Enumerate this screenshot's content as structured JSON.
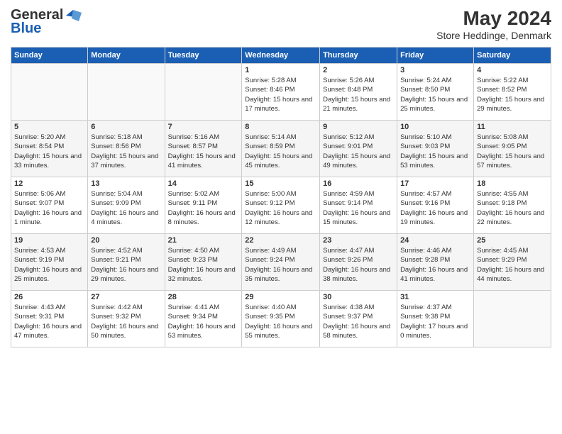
{
  "header": {
    "logo_general": "General",
    "logo_blue": "Blue",
    "title": "May 2024",
    "subtitle": "Store Heddinge, Denmark"
  },
  "calendar": {
    "days_of_week": [
      "Sunday",
      "Monday",
      "Tuesday",
      "Wednesday",
      "Thursday",
      "Friday",
      "Saturday"
    ],
    "weeks": [
      [
        {
          "day": "",
          "sunrise": "",
          "sunset": "",
          "daylight": ""
        },
        {
          "day": "",
          "sunrise": "",
          "sunset": "",
          "daylight": ""
        },
        {
          "day": "",
          "sunrise": "",
          "sunset": "",
          "daylight": ""
        },
        {
          "day": "1",
          "sunrise": "Sunrise: 5:28 AM",
          "sunset": "Sunset: 8:46 PM",
          "daylight": "Daylight: 15 hours and 17 minutes."
        },
        {
          "day": "2",
          "sunrise": "Sunrise: 5:26 AM",
          "sunset": "Sunset: 8:48 PM",
          "daylight": "Daylight: 15 hours and 21 minutes."
        },
        {
          "day": "3",
          "sunrise": "Sunrise: 5:24 AM",
          "sunset": "Sunset: 8:50 PM",
          "daylight": "Daylight: 15 hours and 25 minutes."
        },
        {
          "day": "4",
          "sunrise": "Sunrise: 5:22 AM",
          "sunset": "Sunset: 8:52 PM",
          "daylight": "Daylight: 15 hours and 29 minutes."
        }
      ],
      [
        {
          "day": "5",
          "sunrise": "Sunrise: 5:20 AM",
          "sunset": "Sunset: 8:54 PM",
          "daylight": "Daylight: 15 hours and 33 minutes."
        },
        {
          "day": "6",
          "sunrise": "Sunrise: 5:18 AM",
          "sunset": "Sunset: 8:56 PM",
          "daylight": "Daylight: 15 hours and 37 minutes."
        },
        {
          "day": "7",
          "sunrise": "Sunrise: 5:16 AM",
          "sunset": "Sunset: 8:57 PM",
          "daylight": "Daylight: 15 hours and 41 minutes."
        },
        {
          "day": "8",
          "sunrise": "Sunrise: 5:14 AM",
          "sunset": "Sunset: 8:59 PM",
          "daylight": "Daylight: 15 hours and 45 minutes."
        },
        {
          "day": "9",
          "sunrise": "Sunrise: 5:12 AM",
          "sunset": "Sunset: 9:01 PM",
          "daylight": "Daylight: 15 hours and 49 minutes."
        },
        {
          "day": "10",
          "sunrise": "Sunrise: 5:10 AM",
          "sunset": "Sunset: 9:03 PM",
          "daylight": "Daylight: 15 hours and 53 minutes."
        },
        {
          "day": "11",
          "sunrise": "Sunrise: 5:08 AM",
          "sunset": "Sunset: 9:05 PM",
          "daylight": "Daylight: 15 hours and 57 minutes."
        }
      ],
      [
        {
          "day": "12",
          "sunrise": "Sunrise: 5:06 AM",
          "sunset": "Sunset: 9:07 PM",
          "daylight": "Daylight: 16 hours and 1 minute."
        },
        {
          "day": "13",
          "sunrise": "Sunrise: 5:04 AM",
          "sunset": "Sunset: 9:09 PM",
          "daylight": "Daylight: 16 hours and 4 minutes."
        },
        {
          "day": "14",
          "sunrise": "Sunrise: 5:02 AM",
          "sunset": "Sunset: 9:11 PM",
          "daylight": "Daylight: 16 hours and 8 minutes."
        },
        {
          "day": "15",
          "sunrise": "Sunrise: 5:00 AM",
          "sunset": "Sunset: 9:12 PM",
          "daylight": "Daylight: 16 hours and 12 minutes."
        },
        {
          "day": "16",
          "sunrise": "Sunrise: 4:59 AM",
          "sunset": "Sunset: 9:14 PM",
          "daylight": "Daylight: 16 hours and 15 minutes."
        },
        {
          "day": "17",
          "sunrise": "Sunrise: 4:57 AM",
          "sunset": "Sunset: 9:16 PM",
          "daylight": "Daylight: 16 hours and 19 minutes."
        },
        {
          "day": "18",
          "sunrise": "Sunrise: 4:55 AM",
          "sunset": "Sunset: 9:18 PM",
          "daylight": "Daylight: 16 hours and 22 minutes."
        }
      ],
      [
        {
          "day": "19",
          "sunrise": "Sunrise: 4:53 AM",
          "sunset": "Sunset: 9:19 PM",
          "daylight": "Daylight: 16 hours and 25 minutes."
        },
        {
          "day": "20",
          "sunrise": "Sunrise: 4:52 AM",
          "sunset": "Sunset: 9:21 PM",
          "daylight": "Daylight: 16 hours and 29 minutes."
        },
        {
          "day": "21",
          "sunrise": "Sunrise: 4:50 AM",
          "sunset": "Sunset: 9:23 PM",
          "daylight": "Daylight: 16 hours and 32 minutes."
        },
        {
          "day": "22",
          "sunrise": "Sunrise: 4:49 AM",
          "sunset": "Sunset: 9:24 PM",
          "daylight": "Daylight: 16 hours and 35 minutes."
        },
        {
          "day": "23",
          "sunrise": "Sunrise: 4:47 AM",
          "sunset": "Sunset: 9:26 PM",
          "daylight": "Daylight: 16 hours and 38 minutes."
        },
        {
          "day": "24",
          "sunrise": "Sunrise: 4:46 AM",
          "sunset": "Sunset: 9:28 PM",
          "daylight": "Daylight: 16 hours and 41 minutes."
        },
        {
          "day": "25",
          "sunrise": "Sunrise: 4:45 AM",
          "sunset": "Sunset: 9:29 PM",
          "daylight": "Daylight: 16 hours and 44 minutes."
        }
      ],
      [
        {
          "day": "26",
          "sunrise": "Sunrise: 4:43 AM",
          "sunset": "Sunset: 9:31 PM",
          "daylight": "Daylight: 16 hours and 47 minutes."
        },
        {
          "day": "27",
          "sunrise": "Sunrise: 4:42 AM",
          "sunset": "Sunset: 9:32 PM",
          "daylight": "Daylight: 16 hours and 50 minutes."
        },
        {
          "day": "28",
          "sunrise": "Sunrise: 4:41 AM",
          "sunset": "Sunset: 9:34 PM",
          "daylight": "Daylight: 16 hours and 53 minutes."
        },
        {
          "day": "29",
          "sunrise": "Sunrise: 4:40 AM",
          "sunset": "Sunset: 9:35 PM",
          "daylight": "Daylight: 16 hours and 55 minutes."
        },
        {
          "day": "30",
          "sunrise": "Sunrise: 4:38 AM",
          "sunset": "Sunset: 9:37 PM",
          "daylight": "Daylight: 16 hours and 58 minutes."
        },
        {
          "day": "31",
          "sunrise": "Sunrise: 4:37 AM",
          "sunset": "Sunset: 9:38 PM",
          "daylight": "Daylight: 17 hours and 0 minutes."
        },
        {
          "day": "",
          "sunrise": "",
          "sunset": "",
          "daylight": ""
        }
      ]
    ]
  }
}
